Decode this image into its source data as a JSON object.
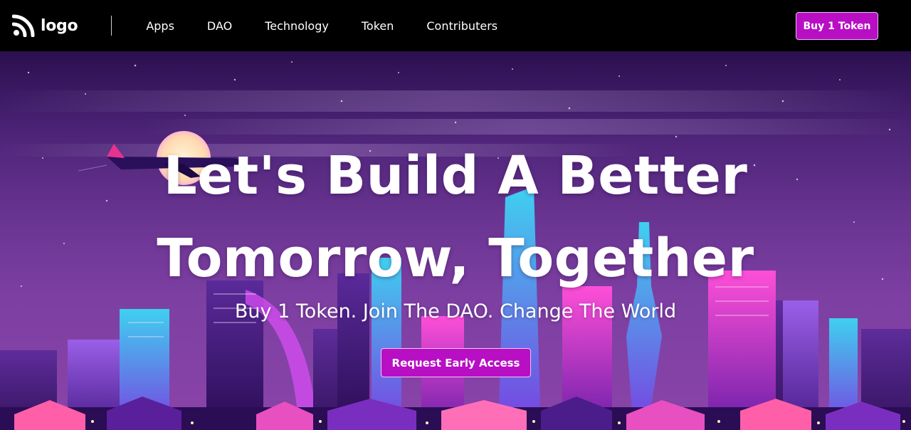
{
  "header": {
    "logo_text": "logo",
    "logo_icon": "rss-feed-icon",
    "nav_items": [
      {
        "label": "Apps"
      },
      {
        "label": "DAO"
      },
      {
        "label": "Technology"
      },
      {
        "label": "Token"
      },
      {
        "label": "Contributers"
      }
    ],
    "buy_button_label": "Buy 1 Token"
  },
  "hero": {
    "title_line1": "Let's Build A Better",
    "title_line2": "Tomorrow, Together",
    "subtitle": "Buy 1 Token. Join The DAO. Change The World",
    "cta_label": "Request Early Access",
    "background_art": "neon-city-skyline-with-airplane-and-moon"
  },
  "colors": {
    "nav_background": "#000000",
    "accent": "#b80fc4",
    "hero_top": "#2b0f4f",
    "hero_bottom": "#8a44a8",
    "text": "#ffffff"
  }
}
